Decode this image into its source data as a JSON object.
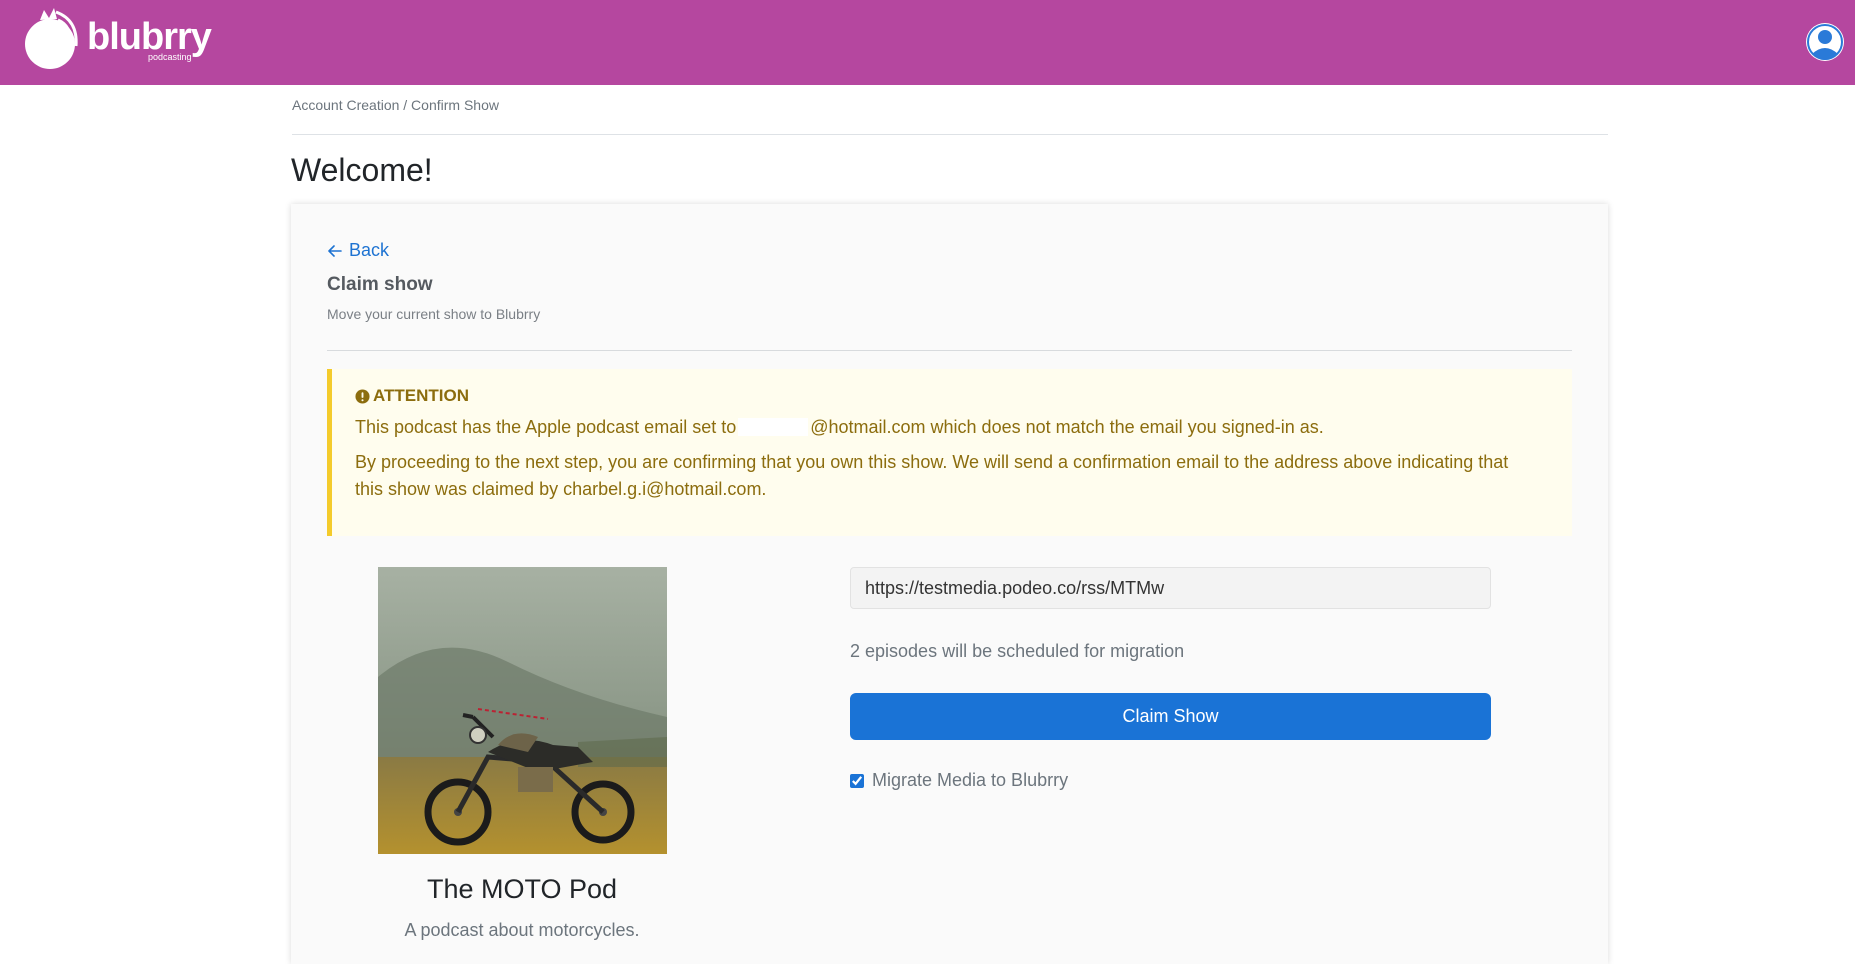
{
  "brand": {
    "name": "blubrry",
    "tagline": "podcasting",
    "color": "#b5479f"
  },
  "header": {
    "user_icon": "user-avatar-icon"
  },
  "breadcrumb": "Account Creation / Confirm Show",
  "page": {
    "title": "Welcome!"
  },
  "card": {
    "back_label": "Back",
    "back_icon": "arrow-left-icon",
    "title": "Claim show",
    "subtitle": "Move your current show to Blubrry"
  },
  "alert": {
    "icon": "exclamation-circle-icon",
    "heading": "ATTENTION",
    "line1_prefix": "This podcast has the Apple podcast email set to",
    "line1_suffix": "@hotmail.com which does not match the email you signed-in as.",
    "line2": "By proceeding to the next step, you are confirming that you own this show. We will send a confirmation email to the address above indicating that this show was claimed by charbel.g.i@hotmail.com."
  },
  "show": {
    "title": "The MOTO Pod",
    "description": "A podcast about motorcycles."
  },
  "form": {
    "feed_url": "https://testmedia.podeo.co/rss/MTMw",
    "episodes_text": "2 episodes will be scheduled for migration",
    "claim_button": "Claim Show",
    "migrate_label": "Migrate Media to Blubrry",
    "migrate_checked": true,
    "accent_color": "#1a73d6"
  }
}
